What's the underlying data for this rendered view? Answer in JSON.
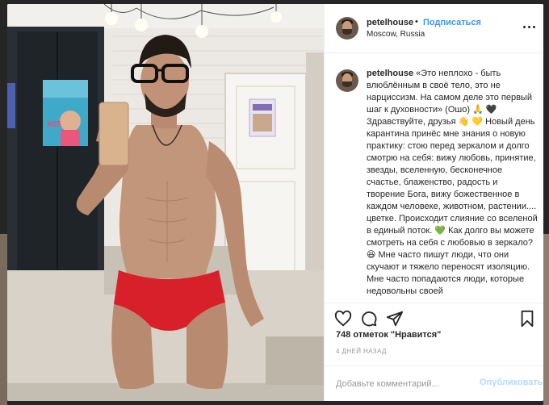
{
  "post": {
    "username": "petelhouse",
    "follow_separator": "•",
    "follow_label": "Подписаться",
    "location": "Moscow, Russia",
    "caption_user": "petelhouse",
    "caption_text": "«Это неплохо - быть влюблённым в своё тело, это не нарциссизм. На самом деле это первый шаг к духовности» (Ошо) 🙏 🖤 Здравствуйте, друзья 👋 💛 Новый день карантина принёс мне знания о новую практику: стою перед зеркалом и долго смотрю на себя: вижу любовь, принятие, звезды, вселенную, бесконечное счастье, блаженство, радость и творение Бога, вижу божественное в каждом человеке, животном, растении.... цветке. Происходит слияние со вселеной в единый поток. 💚 Как долго вы можете смотреть на себя с любовью в зеркало? 😆 Мне часто пишут люди, что они скучают и тяжело переносят изоляцию. Мне часто попадаются люди, которые недовольны своей",
    "likes": "748 отметок \"Нравится\"",
    "time_ago": "4 ДНЕЙ НАЗАД",
    "comment_placeholder": "Добавьте комментарий...",
    "publish_label": "Опубликовать",
    "poster_number": "#05"
  },
  "colors": {
    "link": "#3897f0",
    "publish_disabled": "#b3dbff",
    "text": "#262626",
    "muted": "#999999"
  },
  "icons": {
    "like": "heart-icon",
    "comment": "comment-icon",
    "share": "share-icon",
    "save": "bookmark-icon",
    "more": "more-icon"
  }
}
